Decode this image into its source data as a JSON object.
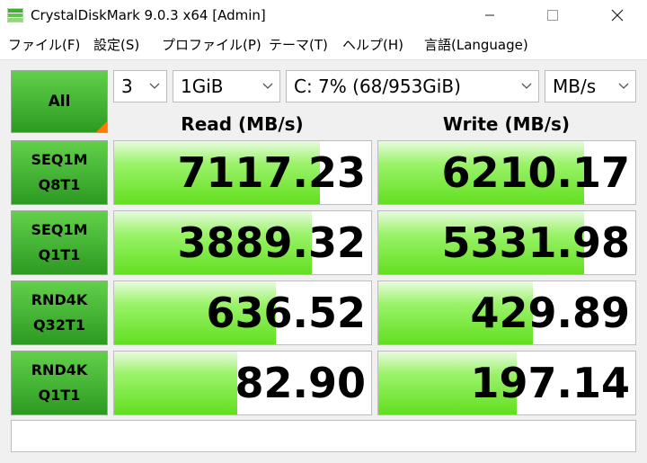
{
  "window": {
    "title": "CrystalDiskMark 9.0.3 x64 [Admin]",
    "controls": {
      "minimize": "minimize",
      "maximize": "maximize",
      "close": "close"
    }
  },
  "menu": [
    "ファイル(F)",
    "設定(S)",
    "プロファイル(P)",
    "テーマ(T)",
    "ヘルプ(H)",
    "言語(Language)"
  ],
  "toolbar": {
    "all_label": "All",
    "count": "3",
    "size": "1GiB",
    "drive": "C: 7% (68/953GiB)",
    "unit": "MB/s"
  },
  "headers": {
    "read": "Read (MB/s)",
    "write": "Write (MB/s)"
  },
  "tests": [
    {
      "line1": "SEQ1M",
      "line2": "Q8T1",
      "read": "7117.23",
      "write": "6210.17",
      "read_fill": 0.8,
      "write_fill": 0.8
    },
    {
      "line1": "SEQ1M",
      "line2": "Q1T1",
      "read": "3889.32",
      "write": "5331.98",
      "read_fill": 0.77,
      "write_fill": 0.8
    },
    {
      "line1": "RND4K",
      "line2": "Q32T1",
      "read": "636.52",
      "write": "429.89",
      "read_fill": 0.63,
      "write_fill": 0.6
    },
    {
      "line1": "RND4K",
      "line2": "Q1T1",
      "read": "82.90",
      "write": "197.14",
      "read_fill": 0.48,
      "write_fill": 0.54
    }
  ],
  "status": ""
}
